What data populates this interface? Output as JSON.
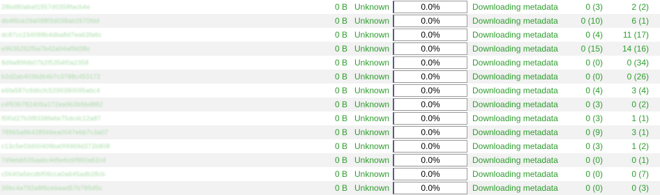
{
  "rows": [
    {
      "name": "28bd80abaf1557d0358facb4e",
      "size": "0 B",
      "eta": "Unknown",
      "progress_text": "0.0%",
      "progress": 0.0,
      "status": "Downloading metadata",
      "seeds": "0 (3)",
      "peers": "2 (2)"
    },
    {
      "name": "db4f6ce29a098f3d038ab2670fdd",
      "size": "0 B",
      "eta": "Unknown",
      "progress_text": "0.0%",
      "progress": 0.0,
      "status": "Downloading metadata",
      "seeds": "0 (10)",
      "peers": "6 (1)"
    },
    {
      "name": "dc87cc234098b4dba8d7ea63fa6c",
      "size": "0 B",
      "eta": "Unknown",
      "progress_text": "0.0%",
      "progress": 0.0,
      "status": "Downloading metadata",
      "seeds": "0 (4)",
      "peers": "11 (17)"
    },
    {
      "name": "e9636262f5a7b42a04af9d38c",
      "size": "0 B",
      "eta": "Unknown",
      "progress_text": "0.0%",
      "progress": 0.0,
      "status": "Downloading metadata",
      "seeds": "0 (15)",
      "peers": "14 (16)"
    },
    {
      "name": "8d9a89fdb07b2f5354f0a2358",
      "size": "0 B",
      "eta": "Unknown",
      "progress_text": "0.0%",
      "progress": 0.0,
      "status": "Downloading metadata",
      "seeds": "0 (0)",
      "peers": "0 (34)"
    },
    {
      "name": "b2d2ab4036db4b7c3788c453172",
      "size": "0 B",
      "eta": "Unknown",
      "progress_text": "0.0%",
      "progress": 0.0,
      "status": "Downloading metadata",
      "seeds": "0 (0)",
      "peers": "0 (26)"
    },
    {
      "name": "e6fa587c9d6cfc5299380095abc4",
      "size": "0 B",
      "eta": "Unknown",
      "progress_text": "0.0%",
      "progress": 0.0,
      "status": "Downloading metadata",
      "seeds": "0 (4)",
      "peers": "3 (4)"
    },
    {
      "name": "c4f936782405a172ea963b5bd882",
      "size": "0 B",
      "eta": "Unknown",
      "progress_text": "0.0%",
      "progress": 0.0,
      "status": "Downloading metadata",
      "seeds": "0 (3)",
      "peers": "0 (2)"
    },
    {
      "name": "f5f0d27b3f8338fa6e75dcdc12a87",
      "size": "0 B",
      "eta": "Unknown",
      "progress_text": "0.0%",
      "progress": 0.0,
      "status": "Downloading metadata",
      "seeds": "0 (3)",
      "peers": "1 (1)"
    },
    {
      "name": "78965a86428566ea0047ebb7c3a07",
      "size": "0 B",
      "eta": "Unknown",
      "progress_text": "0.0%",
      "progress": 0.0,
      "status": "Downloading metadata",
      "seeds": "0 (9)",
      "peers": "3 (1)"
    },
    {
      "name": "c13c5e03d00409ba0f4969d372b808",
      "size": "0 B",
      "eta": "Unknown",
      "progress_text": "0.0%",
      "progress": 0.0,
      "status": "Downloading metadata",
      "seeds": "0 (3)",
      "peers": "1 (2)"
    },
    {
      "name": "7d9ebb535aabc4d5e6cbf960a62c4",
      "size": "0 B",
      "eta": "Unknown",
      "progress_text": "0.0%",
      "progress": 0.0,
      "status": "Downloading metadata",
      "seeds": "0 (0)",
      "peers": "0 (1)"
    },
    {
      "name": "c5640a5ecdbf06cca0a645adb28cb",
      "size": "0 B",
      "eta": "Unknown",
      "progress_text": "0.0%",
      "progress": 0.0,
      "status": "Downloading metadata",
      "seeds": "0 (0)",
      "peers": "0 (7)"
    },
    {
      "name": "39bc4a792a8f6cebaad57b785d5c",
      "size": "0 B",
      "eta": "Unknown",
      "progress_text": "0.0%",
      "progress": 0.0,
      "status": "Downloading metadata",
      "seeds": "0 (0)",
      "peers": "0 (3)"
    }
  ],
  "colors": {
    "text": "#2e9d2e",
    "row_alt_background": "#f2f2f2",
    "progress_fill": "#3a7bd5"
  }
}
